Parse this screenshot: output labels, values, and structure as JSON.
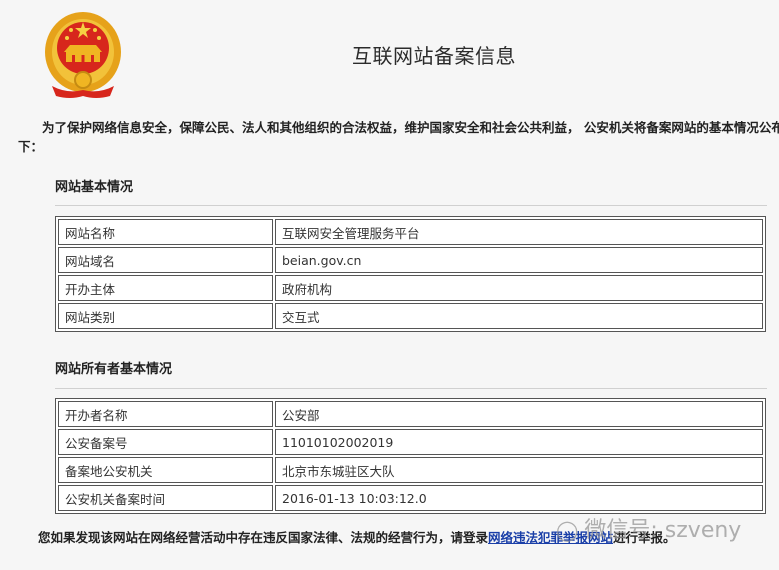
{
  "header": {
    "title": "互联网站备案信息"
  },
  "intro": {
    "line1": "为了保护网络信息安全，保障公民、法人和其他组织的合法权益，维护国家安全和社会公共利益， 公安机关将备案网站的基本情况公布如",
    "line2": "下："
  },
  "site_section": {
    "title": "网站基本情况",
    "rows": [
      {
        "label": "网站名称",
        "value": "互联网安全管理服务平台"
      },
      {
        "label": "网站域名",
        "value": "beian.gov.cn"
      },
      {
        "label": "开办主体",
        "value": "政府机构"
      },
      {
        "label": "网站类别",
        "value": "交互式"
      }
    ]
  },
  "owner_section": {
    "title": "网站所有者基本情况",
    "rows": [
      {
        "label": "开办者名称",
        "value": "公安部"
      },
      {
        "label": "公安备案号",
        "value": "11010102002019"
      },
      {
        "label": "备案地公安机关",
        "value": "北京市东城驻区大队"
      },
      {
        "label": "公安机关备案时间",
        "value": "2016-01-13 10:03:12.0"
      }
    ]
  },
  "footer": {
    "prefix": "您如果发现该网站在网络经营活动中存在违反国家法律、法规的经营行为，请登录",
    "link": "网络违法犯罪举报网站",
    "suffix": "进行举报。"
  },
  "watermark": {
    "icon": "wechat-icon",
    "text": "微信号: szveny"
  },
  "colors": {
    "link": "#1a3fa8",
    "emblem_red": "#d7261c",
    "emblem_gold": "#f0b522"
  }
}
